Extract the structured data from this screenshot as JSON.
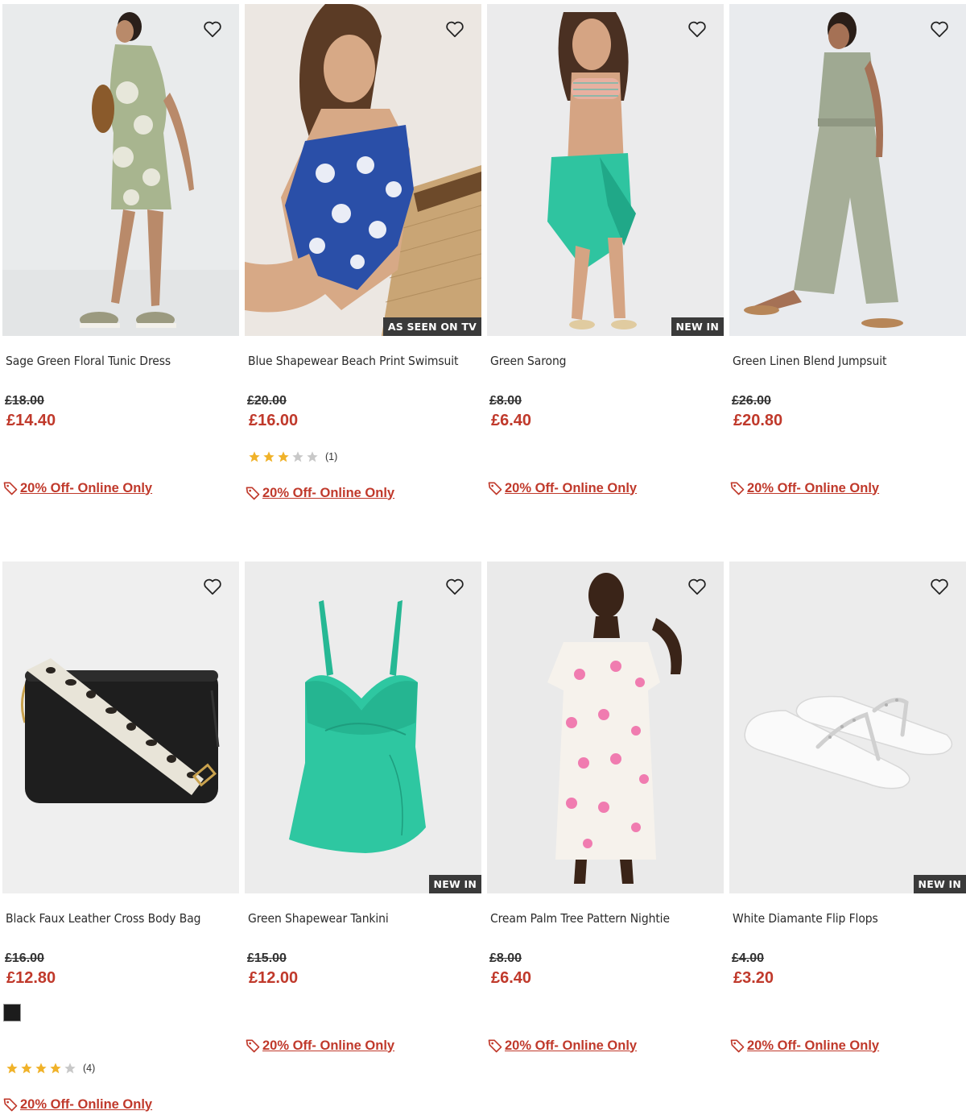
{
  "colors": {
    "price_red": "#c0392b",
    "badge_bg": "#3a3a3a",
    "star_gold": "#f0b229",
    "star_grey": "#c8c8c8"
  },
  "products": [
    {
      "name": "Sage Green Floral Tunic Dress",
      "was": "£18.00",
      "now": "£14.40",
      "badge": "",
      "promo": "20% Off- Online Only"
    },
    {
      "name": "Blue Shapewear Beach Print Swimsuit",
      "was": "£20.00",
      "now": "£16.00",
      "badge": "AS SEEN ON TV",
      "rating": 3,
      "review_count": "(1)",
      "promo": "20% Off- Online Only"
    },
    {
      "name": "Green Sarong",
      "was": "£8.00",
      "now": "£6.40",
      "badge": "NEW IN",
      "promo": "20% Off- Online Only"
    },
    {
      "name": "Green Linen Blend Jumpsuit",
      "was": "£26.00",
      "now": "£20.80",
      "badge": "",
      "promo": "20% Off- Online Only"
    },
    {
      "name": "Black Faux Leather Cross Body Bag",
      "was": "£16.00",
      "now": "£12.80",
      "badge": "",
      "swatch": "black",
      "rating": 4,
      "review_count": "(4)",
      "promo": "20% Off- Online Only"
    },
    {
      "name": "Green Shapewear Tankini",
      "was": "£15.00",
      "now": "£12.00",
      "badge": "NEW IN",
      "promo": "20% Off- Online Only"
    },
    {
      "name": "Cream Palm Tree Pattern Nightie",
      "was": "£8.00",
      "now": "£6.40",
      "badge": "",
      "promo": "20% Off- Online Only"
    },
    {
      "name": "White Diamante Flip Flops",
      "was": "£4.00",
      "now": "£3.20",
      "badge": "NEW IN",
      "promo": "20% Off- Online Only"
    }
  ]
}
